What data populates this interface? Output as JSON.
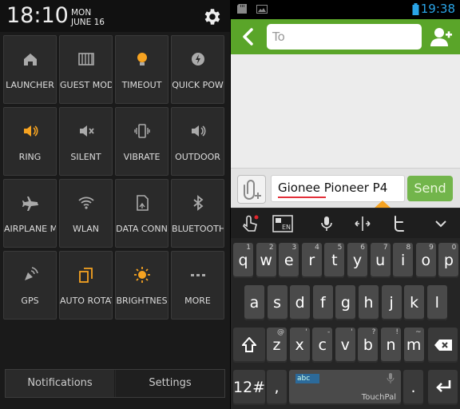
{
  "left": {
    "time": "18:10",
    "day": "MON",
    "date": "JUNE 16",
    "tiles": [
      {
        "label": "LAUNCHER",
        "icon": "home-icon"
      },
      {
        "label": "GUEST MOD",
        "icon": "piano-icon"
      },
      {
        "label": "TIMEOUT",
        "icon": "bulb-icon"
      },
      {
        "label": "QUICK POW",
        "icon": "power-icon"
      },
      {
        "label": "RING",
        "icon": "ring-icon"
      },
      {
        "label": "SILENT",
        "icon": "silent-icon"
      },
      {
        "label": "VIBRATE",
        "icon": "vibrate-icon"
      },
      {
        "label": "OUTDOOR",
        "icon": "outdoor-icon"
      },
      {
        "label": "AIRPLANE M",
        "icon": "airplane-icon"
      },
      {
        "label": "WLAN",
        "icon": "wifi-icon"
      },
      {
        "label": "DATA CONN",
        "icon": "data-icon"
      },
      {
        "label": "BLUETOOTH",
        "icon": "bluetooth-icon"
      },
      {
        "label": "GPS",
        "icon": "gps-icon"
      },
      {
        "label": "AUTO ROTAT",
        "icon": "rotate-icon"
      },
      {
        "label": "BRIGHTNES",
        "icon": "brightness-icon"
      },
      {
        "label": "MORE",
        "icon": "more-icon"
      }
    ],
    "tabs": {
      "notifications": "Notifications",
      "settings": "Settings"
    }
  },
  "right": {
    "status_time": "19:38",
    "to_placeholder": "To",
    "message_text": "Gionee Pioneer P4",
    "send_label": "Send",
    "keyboard": {
      "row1": [
        [
          "q",
          "1"
        ],
        [
          "w",
          "2"
        ],
        [
          "e",
          "3"
        ],
        [
          "r",
          "4"
        ],
        [
          "t",
          "5"
        ],
        [
          "y",
          "6"
        ],
        [
          "u",
          "7"
        ],
        [
          "i",
          "8"
        ],
        [
          "o",
          "9"
        ],
        [
          "p",
          "0"
        ]
      ],
      "row2": [
        "a",
        "s",
        "d",
        "f",
        "g",
        "h",
        "j",
        "k",
        "l"
      ],
      "row3": [
        [
          "z",
          "@"
        ],
        [
          "x",
          "'"
        ],
        [
          "c",
          "-"
        ],
        [
          "v",
          "'"
        ],
        [
          "b",
          "?"
        ],
        [
          "n",
          "!"
        ],
        [
          "m",
          "~"
        ]
      ],
      "sym_label": "12#",
      "comma": ",",
      "period": ".",
      "space_brand": "TouchPal",
      "lang_badge": "abc",
      "en_label": "EN"
    }
  },
  "colors": {
    "accent_orange": "#f6a321",
    "green_bar": "#5aa529",
    "send_green": "#72b54b",
    "status_blue": "#2aa5e8"
  }
}
